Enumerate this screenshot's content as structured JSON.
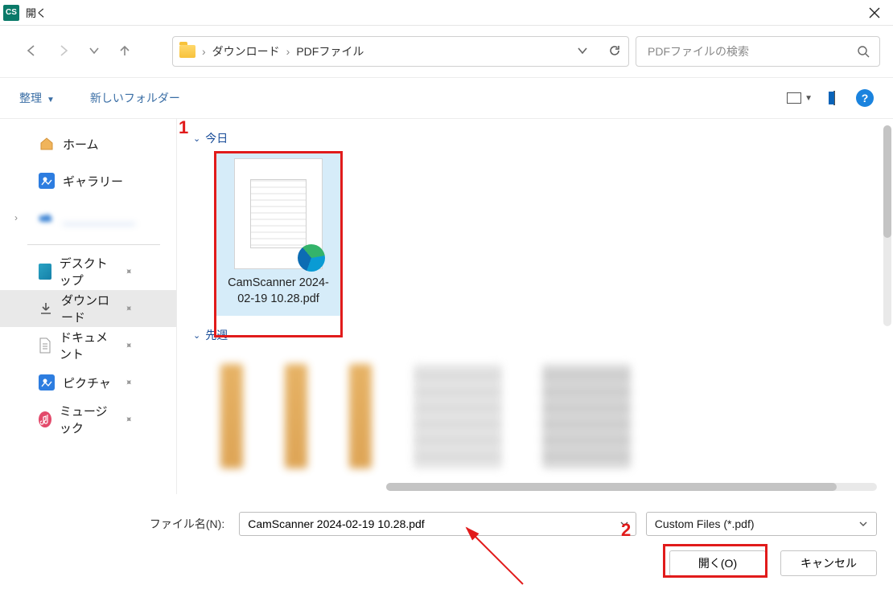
{
  "window": {
    "app_badge": "CS",
    "title": "開く"
  },
  "breadcrumb": {
    "segments": [
      "ダウンロード",
      "PDFファイル"
    ]
  },
  "search": {
    "placeholder": "PDFファイルの検索"
  },
  "toolbar": {
    "organize": "整理",
    "new_folder": "新しいフォルダー",
    "help": "?"
  },
  "sidebar": {
    "home": "ホーム",
    "gallery": "ギャラリー",
    "hidden": "＿＿＿＿＿＿",
    "desktop": "デスクトップ",
    "downloads": "ダウンロード",
    "documents": "ドキュメント",
    "pictures": "ピクチャ",
    "music": "ミュージック"
  },
  "groups": {
    "today": "今日",
    "last_week": "先週"
  },
  "files": {
    "selected_name": "CamScanner 2024-02-19 10.28.pdf"
  },
  "annotations": {
    "one": "1",
    "two": "2"
  },
  "bottom": {
    "filename_label": "ファイル名(N):",
    "filename_value": "CamScanner 2024-02-19 10.28.pdf",
    "filetype_value": "Custom Files (*.pdf)",
    "open": "開く(O)",
    "cancel": "キャンセル"
  }
}
